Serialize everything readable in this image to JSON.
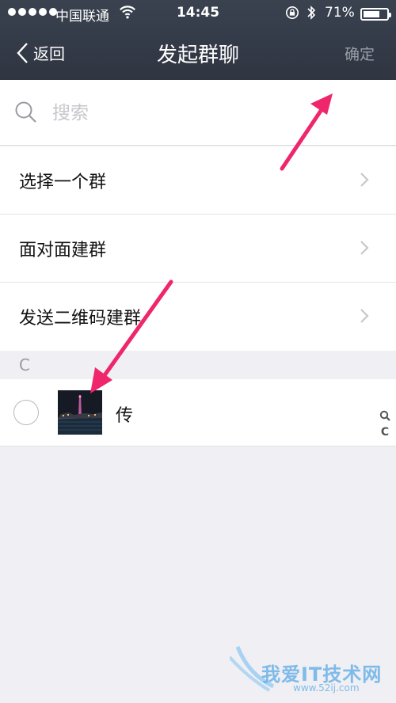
{
  "status_bar": {
    "carrier": "中国联通",
    "time": "14:45",
    "battery_percent_text": "71%",
    "battery_level": 0.71
  },
  "nav": {
    "back_label": "返回",
    "title": "发起群聊",
    "confirm_label": "确定"
  },
  "search": {
    "placeholder": "搜索"
  },
  "options": [
    {
      "label": "选择一个群"
    },
    {
      "label": "面对面建群"
    },
    {
      "label": "发送二维码建群"
    }
  ],
  "contacts": {
    "section_letter": "C",
    "items": [
      {
        "name": "传"
      }
    ]
  },
  "index_bar": {
    "letters": [
      "C"
    ]
  },
  "watermark": {
    "text": "我爱IT技术网",
    "url": "www.52ij.com"
  },
  "colors": {
    "header_bg": "#343b48",
    "annotation_arrow": "#f0266c",
    "page_bg": "#efeff4"
  }
}
